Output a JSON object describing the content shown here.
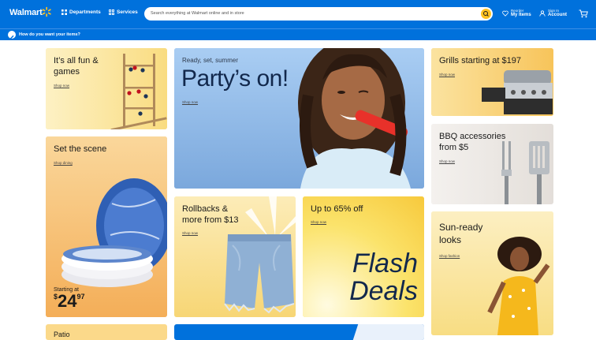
{
  "header": {
    "logo_text": "Walmart",
    "departments": "Departments",
    "services": "Services",
    "search_placeholder": "Search everything at Walmart online and in store",
    "reorder_small": "Reorder",
    "reorder_big": "My Items",
    "signin_small": "Sign In",
    "signin_big": "Account"
  },
  "subbar": {
    "text": "How do you want your items?"
  },
  "cards": {
    "fun": {
      "title_line1": "It’s all fun &",
      "title_line2": "games",
      "link": "Shop now"
    },
    "summer": {
      "kicker": "Ready, set, summer",
      "title": "Party’s on!",
      "link": "Shop now"
    },
    "grills": {
      "title": "Grills starting at $197",
      "link": "Shop now"
    },
    "scene": {
      "title": "Set the scene",
      "link": "Shop dining",
      "price_prefix": "Starting at",
      "price_dollar": "$",
      "price_main": "24",
      "price_cents": "97"
    },
    "bbq": {
      "title_line1": "BBQ accessories",
      "title_line2": "from $5",
      "link": "Shop now"
    },
    "rollbacks": {
      "title_line1": "Rollbacks &",
      "title_line2": "more from $13",
      "link": "Shop now"
    },
    "flash": {
      "title": "Up to 65% off",
      "link": "Shop now",
      "big1": "Flash",
      "big2": "Deals"
    },
    "sun": {
      "title_line1": "Sun-ready",
      "title_line2": "looks",
      "link": "Shop fashion"
    },
    "bottom_left": {
      "title": "Patio"
    }
  },
  "colors": {
    "brand_blue": "#0071dc",
    "spark_yellow": "#ffc220"
  }
}
